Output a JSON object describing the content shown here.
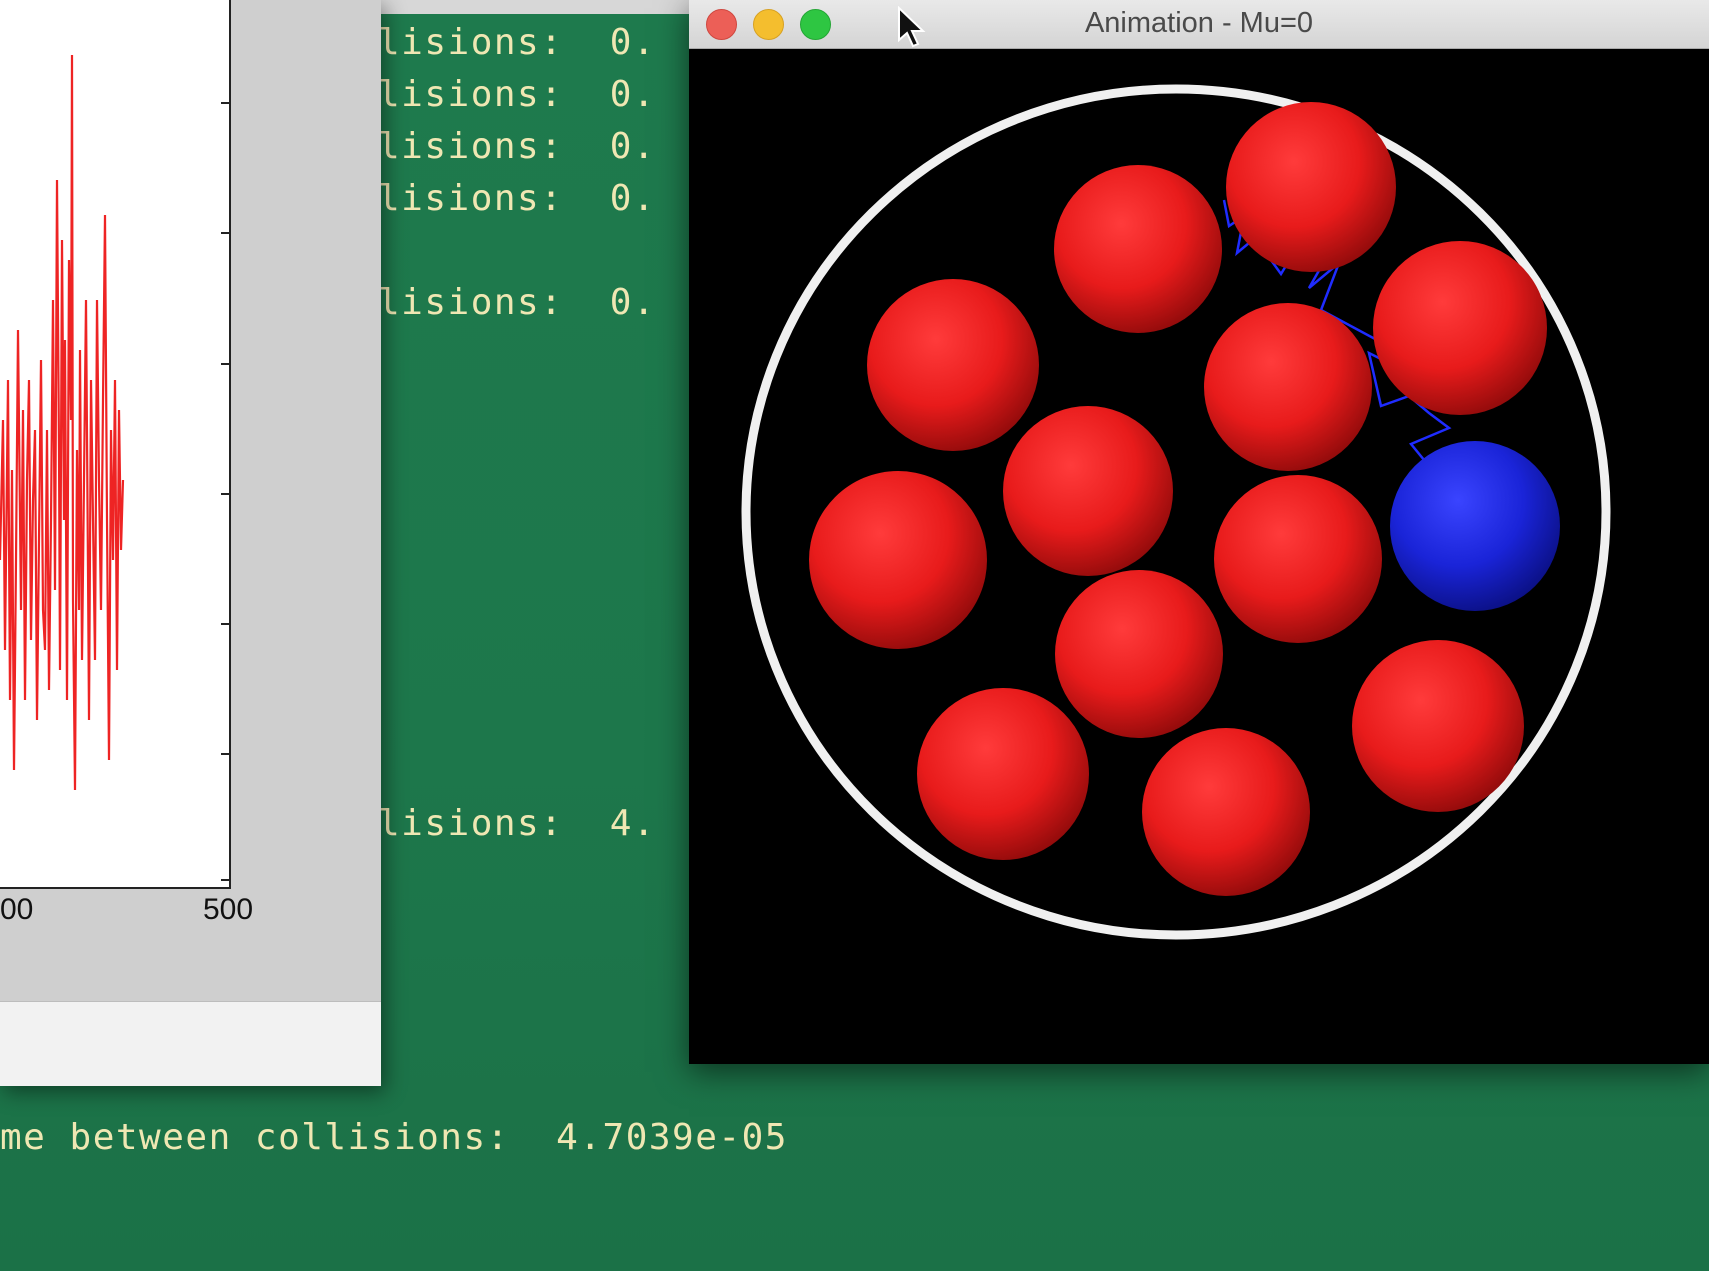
{
  "terminal": {
    "lines": [
      "lisions:  0.",
      "lisions:  0.",
      "lisions:  0.",
      "lisions:  0.",
      "lisions:  0.",
      "lisions:  4.",
      "me between collisions:  4.7039e-05"
    ]
  },
  "plot_window": {
    "x_tick_labels": [
      "00",
      "500"
    ],
    "line_color": "#ee2424"
  },
  "animation_window": {
    "title": "Animation - Mu=0",
    "buttons": [
      "close-icon",
      "minimize-icon",
      "maximize-icon"
    ],
    "ring_color": "#f2f2f2",
    "ball_color": "#e81b1b",
    "tracer_ball_color": "#1a24d8",
    "path_color": "#1f2cff"
  }
}
